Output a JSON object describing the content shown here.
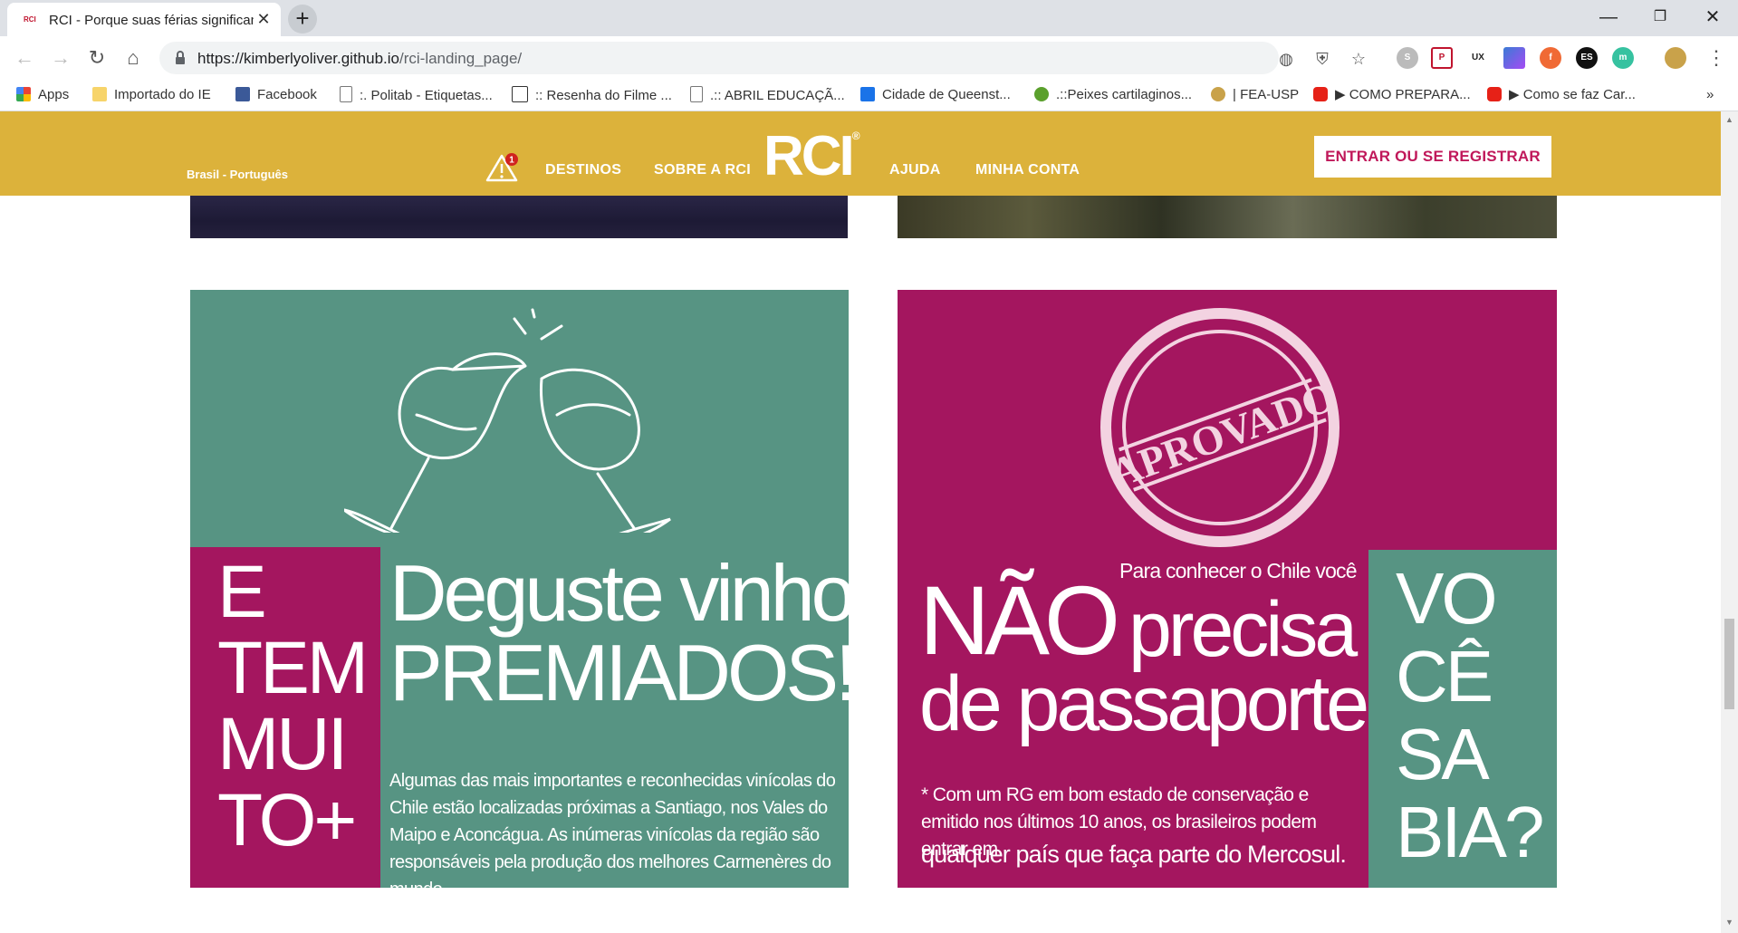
{
  "browser": {
    "tab_title": "RCI - Porque suas férias significam",
    "tab_favicon": "RCI",
    "url_host": "https://kimberlyoliver.github.io",
    "url_path": "/rci-landing_page/",
    "newtab": "+",
    "close": "✕",
    "minimize": "—",
    "maximize": "❐",
    "win_close": "✕"
  },
  "bookmarks": [
    {
      "label": "Apps",
      "icon": "apps-grid-icon"
    },
    {
      "label": "Importado do IE",
      "icon": "folder-icon"
    },
    {
      "label": "Facebook",
      "icon": "facebook-icon"
    },
    {
      "label": ":. Politab - Etiquetas...",
      "icon": "page-icon"
    },
    {
      "label": ":: Resenha do Filme ...",
      "icon": "dvd-icon"
    },
    {
      "label": ".:: ABRIL EDUCAÇÃ...",
      "icon": "page-icon"
    },
    {
      "label": "Cidade de Queenst...",
      "icon": "google-icon"
    },
    {
      "label": ".::Peixes cartilaginos...",
      "icon": "fish-icon"
    },
    {
      "label": "| FEA-USP",
      "icon": "fea-icon"
    },
    {
      "label": "▶ COMO PREPARA...",
      "icon": "youtube-icon"
    },
    {
      "label": "▶ Como se faz Car...",
      "icon": "youtube-icon"
    }
  ],
  "bookmarks_more": "»",
  "header": {
    "lang": "Brasil - Português",
    "nav": [
      "DESTINOS",
      "SOBRE A RCI",
      "AJUDA",
      "MINHA CONTA"
    ],
    "logo": "RCI",
    "logo_reg": "®",
    "alert_badge": "1",
    "enter_button": "ENTRAR OU SE REGISTRAR"
  },
  "card_wine": {
    "side_words": [
      "E",
      "TEM",
      "MUI",
      "TO+"
    ],
    "headline_line1": "Deguste vinhos",
    "headline_line2": "PREMIADOS!",
    "paragraph": "Algumas das mais importantes e reconhecidas vinícolas do Chile estão localizadas próximas a Santiago, nos Vales do Maipo e Aconcágua. As inúmeras vinícolas da região são responsáveis pela produção dos melhores Carmenères do mundo."
  },
  "card_passport": {
    "stamp_text": "APROVADO",
    "small_intro": "Para conhecer o Chile você",
    "big_word": "NÃO",
    "word_precisa": "precisa",
    "line_passaporte": "de passaporte!",
    "footnote": "* Com um RG em bom estado de conservação e emitido nos últimos 10 anos, os brasileiros podem entrar em",
    "footnote_big": "qualquer país que faça parte do Mercosul.",
    "side_words": [
      "VO",
      "CÊ",
      "SA",
      "BIA?"
    ]
  },
  "colors": {
    "header_gold": "#dcb23b",
    "magenta": "#a4165f",
    "teal": "#579483"
  }
}
